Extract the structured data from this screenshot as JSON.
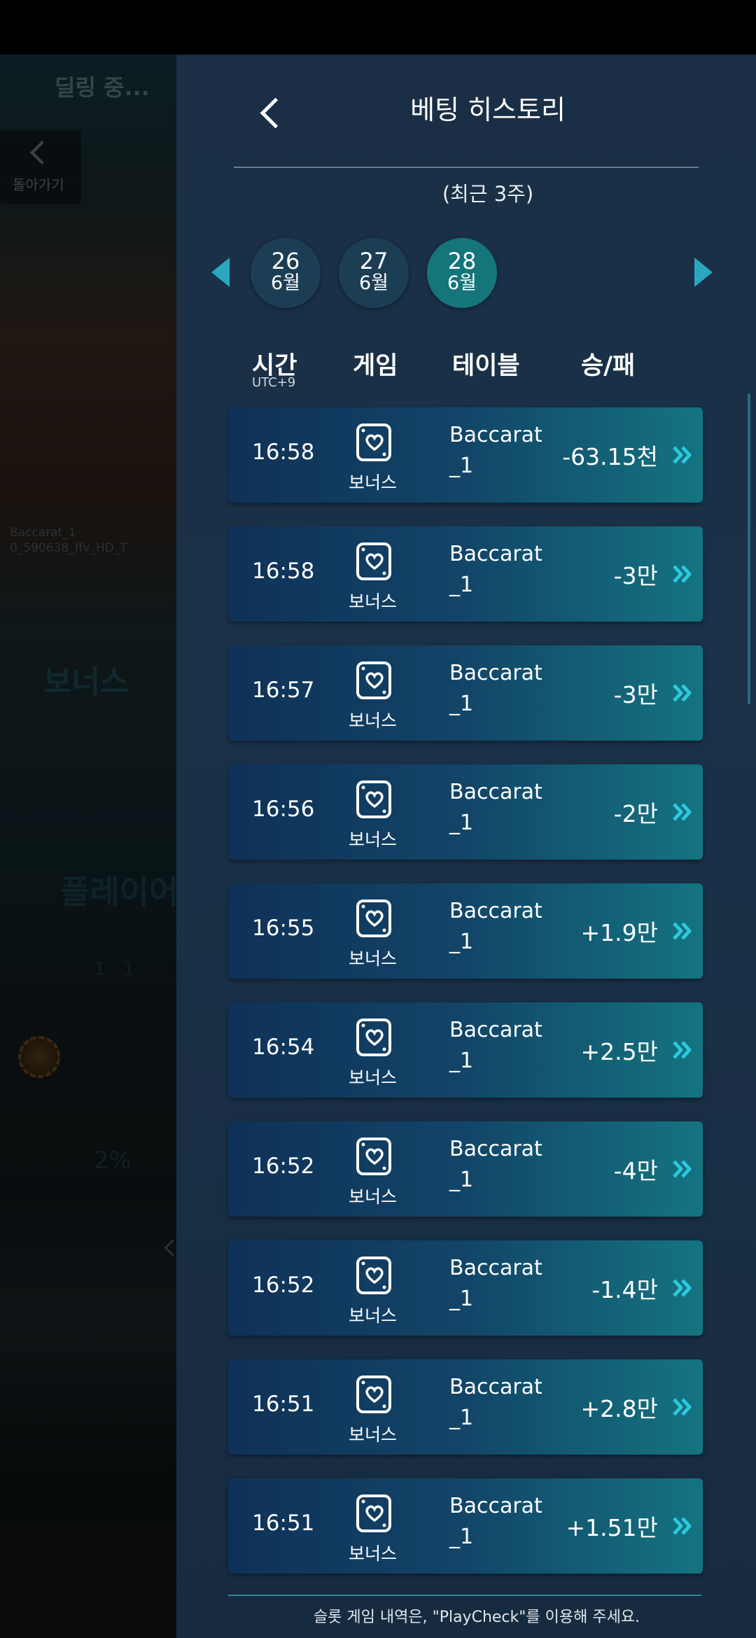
{
  "game_screen": {
    "status_text": "딜링 중...",
    "back_label": "돌아가기",
    "table_info_1": "Baccarat_1",
    "table_info_2": "0_590638_ffv_HD_T",
    "bonus_label": "보너스",
    "player_label": "플레이어",
    "ratio": "1 : 1",
    "percent": "2%"
  },
  "panel": {
    "title": "베팅 히스토리",
    "period": "(최근 3주)",
    "dates": [
      {
        "day": "26",
        "month": "6월",
        "active": false
      },
      {
        "day": "27",
        "month": "6월",
        "active": false
      },
      {
        "day": "28",
        "month": "6월",
        "active": true
      }
    ],
    "columns": {
      "time": "시간",
      "timezone": "UTC+9",
      "game": "게임",
      "table": "테이블",
      "result": "승/패"
    },
    "rows": [
      {
        "time": "16:58",
        "game": "보너스",
        "table": "Baccarat",
        "table_no": "_1",
        "amount": "-63.15천"
      },
      {
        "time": "16:58",
        "game": "보너스",
        "table": "Baccarat",
        "table_no": "_1",
        "amount": "-3만"
      },
      {
        "time": "16:57",
        "game": "보너스",
        "table": "Baccarat",
        "table_no": "_1",
        "amount": "-3만"
      },
      {
        "time": "16:56",
        "game": "보너스",
        "table": "Baccarat",
        "table_no": "_1",
        "amount": "-2만"
      },
      {
        "time": "16:55",
        "game": "보너스",
        "table": "Baccarat",
        "table_no": "_1",
        "amount": "+1.9만"
      },
      {
        "time": "16:54",
        "game": "보너스",
        "table": "Baccarat",
        "table_no": "_1",
        "amount": "+2.5만"
      },
      {
        "time": "16:52",
        "game": "보너스",
        "table": "Baccarat",
        "table_no": "_1",
        "amount": "-4만"
      },
      {
        "time": "16:52",
        "game": "보너스",
        "table": "Baccarat",
        "table_no": "_1",
        "amount": "-1.4만"
      },
      {
        "time": "16:51",
        "game": "보너스",
        "table": "Baccarat",
        "table_no": "_1",
        "amount": "+2.8만"
      },
      {
        "time": "16:51",
        "game": "보너스",
        "table": "Baccarat",
        "table_no": "_1",
        "amount": "+1.51만"
      }
    ],
    "footer": "슬롯 게임 내역은, \"PlayCheck\"를 이용해 주세요.",
    "icons": {
      "back": "chevron-left-icon",
      "prev": "triangle-left-icon",
      "next": "triangle-right-icon",
      "game": "heart-card-icon",
      "row_detail": "double-chevron-right-icon"
    },
    "colors": {
      "accent": "#2aa7c0",
      "active_date": "#14757a",
      "row_start": "#0f3157",
      "row_end": "#147480"
    }
  }
}
